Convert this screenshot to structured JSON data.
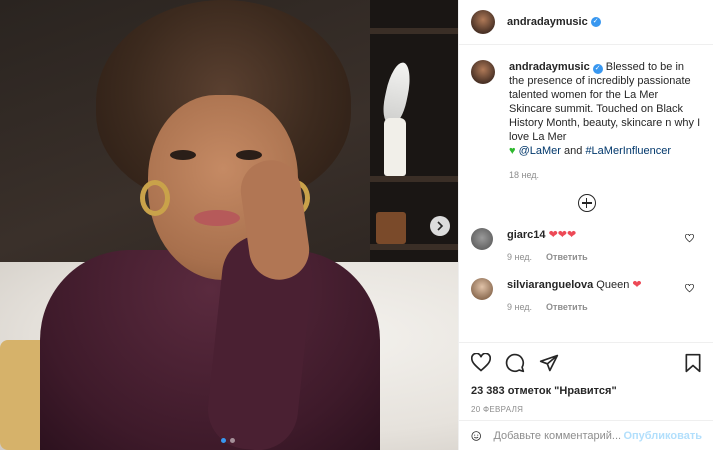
{
  "post": {
    "username": "andradaymusic",
    "verified": true,
    "photo_alt": "Selfie",
    "carousel_count": 2,
    "carousel_active": 0
  },
  "caption": {
    "username": "andradaymusic",
    "text_1": "Blessed to be in the presence of incredibly passionate talented women for the La Mer Skincare summit. Touched on Black History Month, beauty, skincare n why I love La Mer",
    "mention": "@LaMer",
    "and_word": "and",
    "hashtag": "#LaMerInfluencer",
    "time": "18 нед."
  },
  "comments": [
    {
      "username": "giarc14",
      "text": "❤❤❤",
      "time": "9 нед.",
      "reply": "Ответить"
    },
    {
      "username": "silviaranguelova",
      "text": "Queen",
      "emoji": "❤",
      "time": "9 нед.",
      "reply": "Ответить"
    }
  ],
  "likes": "23 383 отметок \"Нравится\"",
  "date": "20 ФЕВРАЛЯ",
  "add_comment": {
    "placeholder": "Добавьте комментарий...",
    "post": "Опубликовать"
  },
  "icons": [
    "heart-icon",
    "comment-icon",
    "share-icon",
    "bookmark-icon",
    "emoji-icon",
    "plus-icon",
    "chevron-right-icon"
  ],
  "colors": {
    "accent": "#3897f0",
    "heart": "#ed4956",
    "link": "#00376b",
    "muted": "#8e8e8e"
  }
}
